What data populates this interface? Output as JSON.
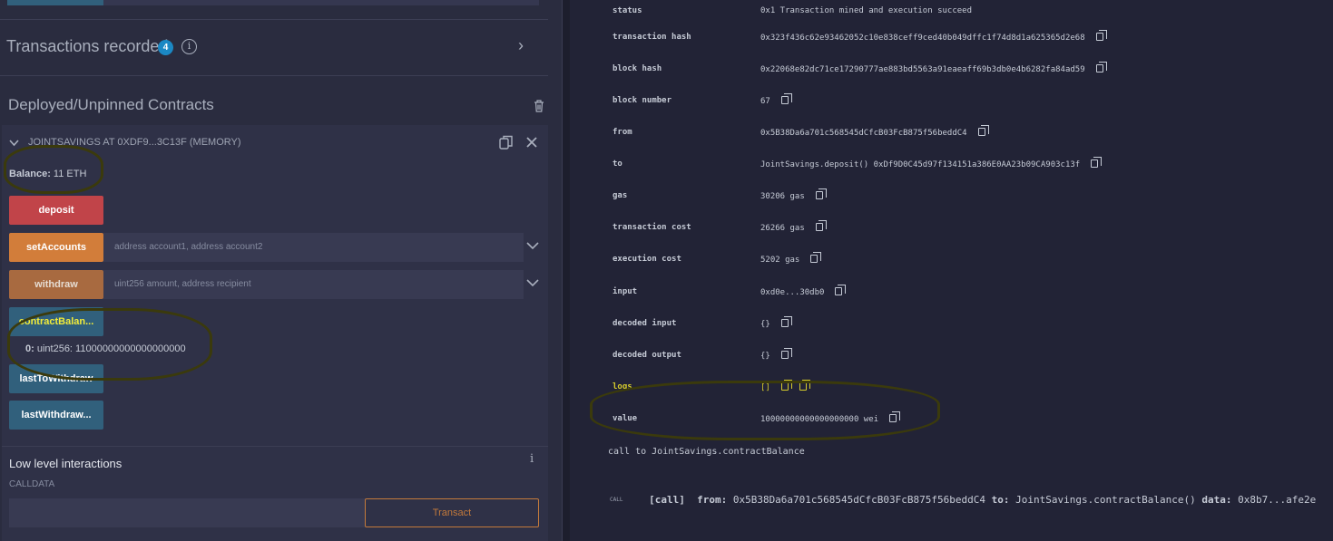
{
  "transactions": {
    "title": "Transactions recorded",
    "count": "4"
  },
  "deployed": {
    "title": "Deployed/Unpinned Contracts",
    "contract_name": "JOINTSAVINGS AT 0XDF9...3C13F (MEMORY)",
    "balance_label": "Balance:",
    "balance_value": "11 ETH",
    "functions": [
      {
        "label": "deposit",
        "placeholder": ""
      },
      {
        "label": "setAccounts",
        "placeholder": "address account1, address account2"
      },
      {
        "label": "withdraw",
        "placeholder": "uint256 amount, address recipient"
      },
      {
        "label": "contractBalan...",
        "placeholder": ""
      },
      {
        "label": "lastToWithdraw",
        "placeholder": ""
      },
      {
        "label": "lastWithdraw...",
        "placeholder": ""
      }
    ],
    "result_index": "0:",
    "result_value": "uint256: 11000000000000000000"
  },
  "low_level": {
    "title": "Low level interactions",
    "calldata_label": "CALLDATA",
    "transact_label": "Transact"
  },
  "tx_details": [
    {
      "key": "status",
      "value": "0x1 Transaction mined and execution succeed"
    },
    {
      "key": "transaction hash",
      "value": "0x323f436c62e93462052c10e838ceff9ced40b049dffc1f74d8d1a625365d2e68"
    },
    {
      "key": "block hash",
      "value": "0x22068e82dc71ce17290777ae883bd5563a91eaeaff69b3db0e4b6282fa84ad59"
    },
    {
      "key": "block number",
      "value": "67"
    },
    {
      "key": "from",
      "value": "0x5B38Da6a701c568545dCfcB03FcB875f56beddC4"
    },
    {
      "key": "to",
      "value": "JointSavings.deposit() 0xDf9D0C45d97f134151a386E0AA23b09CA903c13f"
    },
    {
      "key": "gas",
      "value": "30206 gas"
    },
    {
      "key": "transaction cost",
      "value": "26266 gas"
    },
    {
      "key": "execution cost",
      "value": "5202 gas"
    },
    {
      "key": "input",
      "value": "0xd0e...30db0"
    },
    {
      "key": "decoded input",
      "value": "{}"
    },
    {
      "key": "decoded output",
      "value": "{}"
    },
    {
      "key": "logs",
      "value": "[]"
    },
    {
      "key": "value",
      "value": "10000000000000000000 wei"
    }
  ],
  "call_to": "call to JointSavings.contractBalance",
  "call_line": {
    "tag": "CALL",
    "kind": "[call]",
    "from_label": "from:",
    "from": "0x5B38Da6a701c568545dCfcB03FcB875f56beddC4",
    "to_label": "to:",
    "to": "JointSavings.contractBalance()",
    "data_label": "data:",
    "data": "0x8b7...afe2e"
  },
  "colors": {
    "deposit": "#c14449",
    "setAccounts": "#d27d3a",
    "withdraw": "#a86a40",
    "call": "#31607c",
    "accent": "#1b88c4"
  },
  "icons": [
    "info-icon",
    "chevron-right-icon",
    "trash-icon",
    "chevron-down-icon",
    "copy-icon",
    "close-icon"
  ]
}
